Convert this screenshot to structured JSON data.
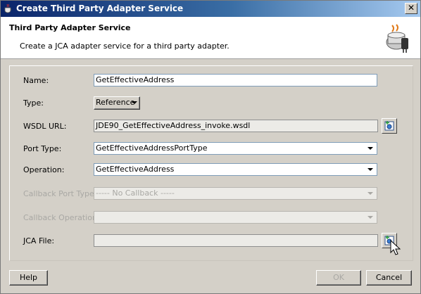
{
  "window": {
    "title": "Create Third Party Adapter Service",
    "close_glyph": "✕"
  },
  "header": {
    "title": "Third Party Adapter Service",
    "subtitle": "Create a JCA adapter service for a third party adapter.",
    "icon": "adapter-plug-icon"
  },
  "form": {
    "name_label": "Name:",
    "name_value": "GetEffectiveAddress",
    "type_label": "Type:",
    "type_value": "Reference",
    "wsdl_label": "WSDL URL:",
    "wsdl_value": "JDE90_GetEffectiveAddress_invoke.wsdl",
    "port_type_label": "Port Type:",
    "port_type_value": "GetEffectiveAddressPortType",
    "operation_label": "Operation:",
    "operation_value": "GetEffectiveAddress",
    "callback_port_type_label": "Callback Port Type:",
    "callback_port_type_value": "----- No Callback -----",
    "callback_operation_label": "Callback Operation:",
    "callback_operation_value": "",
    "jca_file_label": "JCA File:",
    "jca_file_value": ""
  },
  "buttons": {
    "help": "Help",
    "ok": "OK",
    "cancel": "Cancel"
  },
  "colors": {
    "title_start": "#0a246a",
    "title_end": "#a6caf0",
    "dialog_bg": "#d4d0c8"
  }
}
